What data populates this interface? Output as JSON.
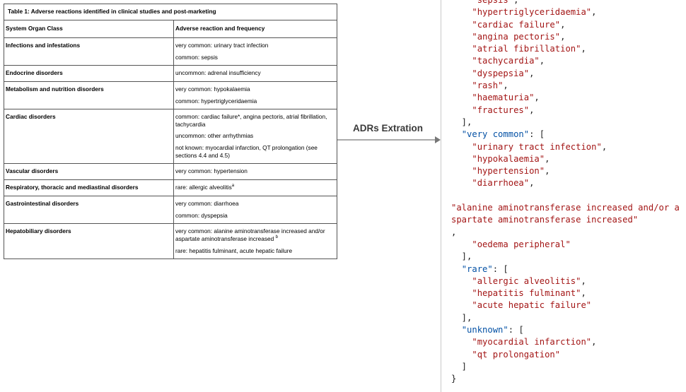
{
  "table": {
    "caption": "Table 1: Adverse reactions identified in clinical studies and post-marketing",
    "col1_header": "System Organ Class",
    "col2_header": "Adverse reaction and frequency",
    "rows": [
      {
        "soc": "Infections and infestations",
        "lines": [
          "very common: urinary tract infection",
          "common: sepsis"
        ]
      },
      {
        "soc": "Endocrine disorders",
        "lines": [
          "uncommon: adrenal insufficiency"
        ]
      },
      {
        "soc": "Metabolism and nutrition disorders",
        "lines": [
          "very common: hypokalaemia",
          "common: hypertriglyceridaemia"
        ]
      },
      {
        "soc": "Cardiac disorders",
        "lines": [
          "common: cardiac failure*, angina pectoris, atrial fibrillation, tachycardia",
          "uncommon: other arrhythmias",
          "not known: myocardial infarction, QT prolongation (see sections 4.4 and 4.5)"
        ]
      },
      {
        "soc": "Vascular disorders",
        "lines": [
          "very common: hypertension"
        ]
      },
      {
        "soc": "Respiratory, thoracic and mediastinal disorders",
        "lines": [
          "rare: allergic alveolitis"
        ],
        "sup": "a"
      },
      {
        "soc": "Gastrointestinal disorders",
        "lines": [
          "very common: diarrhoea",
          "common: dyspepsia"
        ]
      },
      {
        "soc": "Hepatobiliary disorders",
        "lines": [
          "very common: alanine aminotransferase increased and/or aspartate aminotransferase increased",
          "rare: hepatitis fulminant, acute hepatic failure"
        ],
        "sup": "b"
      }
    ]
  },
  "arrow": {
    "label": "ADRs Extration"
  },
  "json_view": {
    "common_tail": [
      "sepsis",
      "hypertriglyceridaemia",
      "cardiac failure",
      "angina pectoris",
      "atrial fibrillation",
      "tachycardia",
      "dyspepsia",
      "rash",
      "haematuria",
      "fractures"
    ],
    "very_common_key": "very common",
    "very_common": [
      "urinary tract infection",
      "hypokalaemia",
      "hypertension",
      "diarrhoea"
    ],
    "long_item": "alanine aminotransferase increased and/or aspartate aminotransferase increased",
    "very_common_last": "oedema peripheral",
    "rare_key": "rare",
    "rare": [
      "allergic alveolitis",
      "hepatitis fulminant",
      "acute hepatic failure"
    ],
    "unknown_key": "unknown",
    "unknown": [
      "myocardial infarction",
      "qt prolongation"
    ]
  },
  "colors": {
    "string": "#a31515",
    "key": "#0451a5",
    "border": "#555555"
  }
}
